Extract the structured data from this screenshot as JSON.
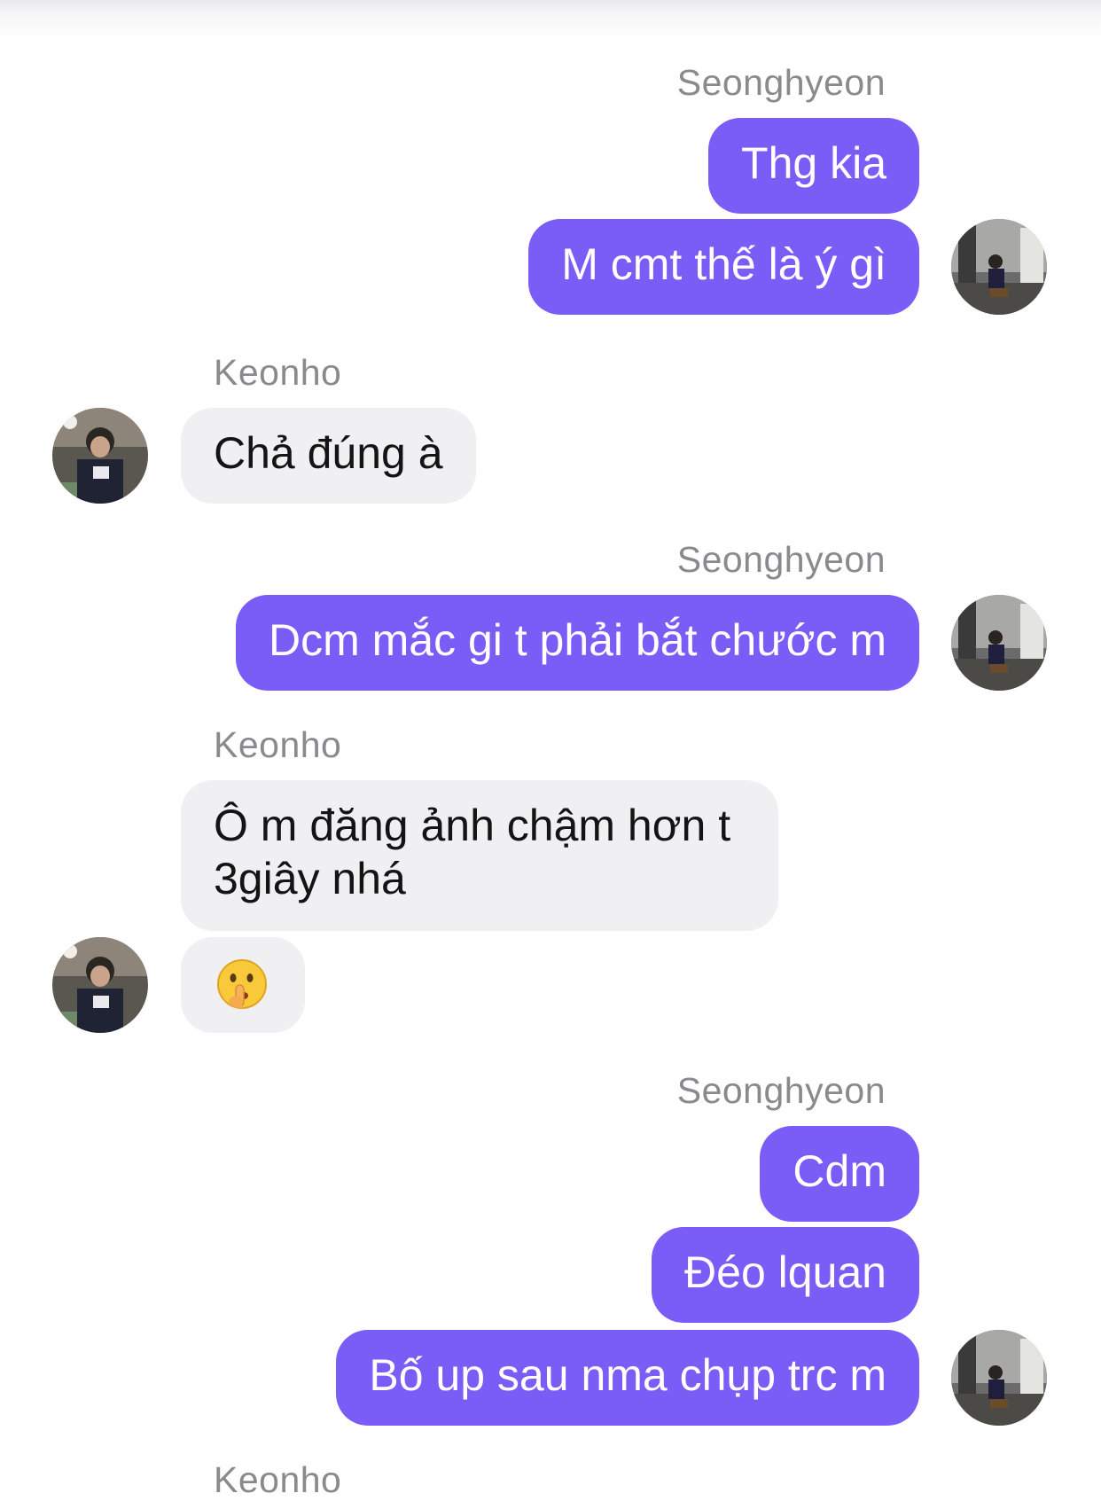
{
  "participants": {
    "me": "Seonghyeon",
    "them": "Keonho"
  },
  "messages": [
    {
      "sender_label": "Seonghyeon",
      "bubbles": [
        "Thg kia",
        "M cmt thế là ý gì"
      ]
    },
    {
      "sender_label": "Keonho",
      "bubbles": [
        "Chả đúng à"
      ]
    },
    {
      "sender_label": "Seonghyeon",
      "bubbles": [
        "Dcm mắc gi t phải bắt chước m"
      ]
    },
    {
      "sender_label": "Keonho",
      "bubbles": [
        "Ô m đăng ảnh chậm hơn t 3giây nhá",
        "shushing-face-emoji"
      ]
    },
    {
      "sender_label": "Seonghyeon",
      "bubbles": [
        "Cdm",
        "Đéo lquan",
        "Bố up sau nma chụp trc m"
      ]
    },
    {
      "sender_label": "Keonho",
      "bubbles": []
    }
  ],
  "colors": {
    "outgoing_bubble": "#7a5cf6",
    "incoming_bubble": "#f0f0f2",
    "sender_label": "#8a8a8e"
  },
  "icons": {
    "me_avatar": "user-photo-avatar",
    "them_avatar": "user-photo-avatar",
    "reaction": "shushing-face-emoji"
  }
}
